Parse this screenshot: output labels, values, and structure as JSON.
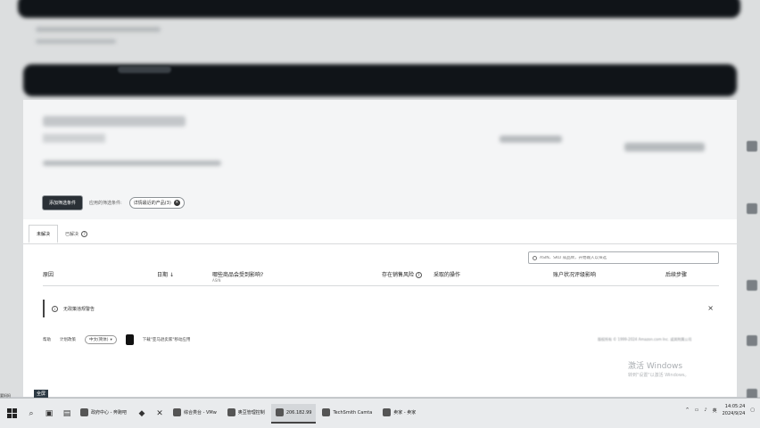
{
  "filters": {
    "add_button": "添加筛选条件",
    "applied_label": "应用的筛选条件:",
    "chip_label": "详情最近的产品(3)",
    "chip_remove": "×"
  },
  "tabs": [
    {
      "label": "未解决"
    },
    {
      "label": "已解决"
    }
  ],
  "search": {
    "placeholder": "ASIN、SKU 或品牌，开始输入以筛选"
  },
  "table": {
    "columns": {
      "reason": "原因",
      "date": "日期",
      "date_sort": "↓",
      "affected": "哪些商品会受到影响?",
      "affected_sub": "ASIN",
      "risk": "存在销售风险",
      "action": "采取的操作",
      "account_impact": "账户状况评级影响",
      "next_steps": "后续步骤"
    },
    "empty_message": "无政策违规警告",
    "close": "×"
  },
  "footer": {
    "help": "帮助",
    "program_policy": "计划政策",
    "language": "中文(简体)",
    "app_download": "下载\"亚马逊卖家\"移动应用",
    "copyright": "版权所有 © 1999-2024 Amazon.com Inc. 或其附属公司"
  },
  "watermark": {
    "title": "激活 Windows",
    "subtitle": "转到\"设置\"以激活 Windows。"
  },
  "overlay": {
    "tag": "全屏",
    "corner": "要妈妈"
  },
  "taskbar": {
    "tasks": [
      {
        "label": "政府中心 - 奔跑吧"
      },
      {
        "label": "综合类台 - VMw"
      },
      {
        "label": "奥豆管理控制"
      },
      {
        "label": "206.182.99"
      },
      {
        "label": "TechSmith Camta"
      },
      {
        "label": "卖家 - 卖家"
      }
    ],
    "tray_label": "英",
    "time": "14:05:24",
    "date": "2024/9/24"
  }
}
